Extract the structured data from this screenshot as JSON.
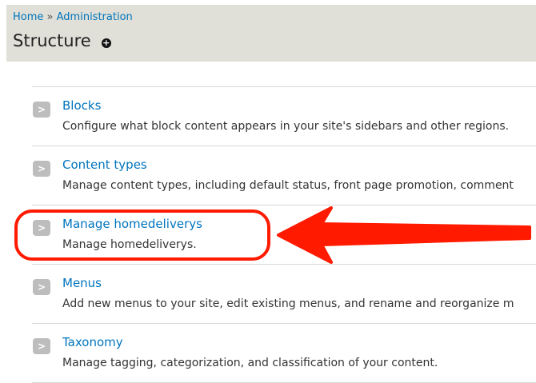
{
  "breadcrumb": {
    "home": "Home",
    "separator": "»",
    "admin": "Administration"
  },
  "page": {
    "title": "Structure",
    "shortcut_icon": "plus-circle-icon"
  },
  "items": [
    {
      "label": "Blocks",
      "description": "Configure what block content appears in your site's sidebars and other regions."
    },
    {
      "label": "Content types",
      "description": "Manage content types, including default status, front page promotion, comment"
    },
    {
      "label": "Manage homedeliverys",
      "description": "Manage homedeliverys."
    },
    {
      "label": "Menus",
      "description": "Add new menus to your site, edit existing menus, and rename and reorganize m"
    },
    {
      "label": "Taxonomy",
      "description": "Manage tagging, categorization, and classification of your content."
    }
  ],
  "annotation": {
    "color": "#ff1a00",
    "highlighted_item": "Manage homedeliverys"
  },
  "colors": {
    "link": "#0074bd",
    "header_bg": "#e0e0d8",
    "chevron_bg": "#bdbdbd"
  }
}
